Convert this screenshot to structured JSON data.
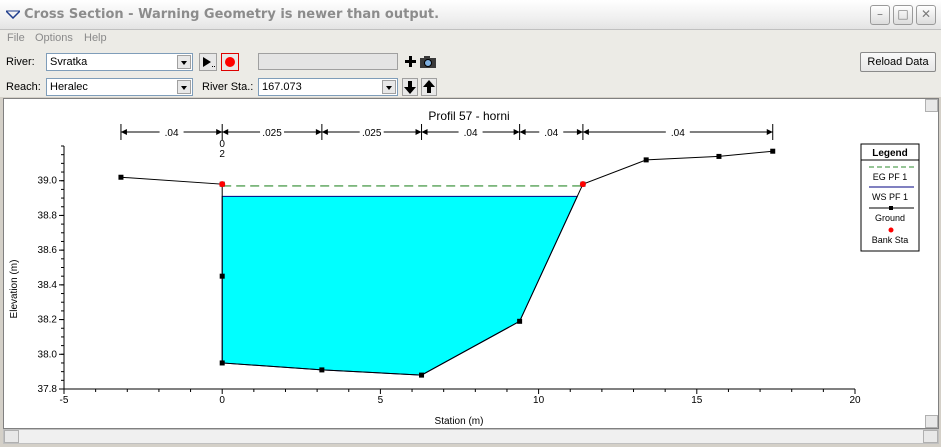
{
  "window": {
    "title": "Cross Section - Warning Geometry is newer than output."
  },
  "menu": [
    "File",
    "Options",
    "Help"
  ],
  "toolbar": {
    "river_label": "River:",
    "river_value": "Svratka",
    "reach_label": "Reach:",
    "reach_value": "Heralec",
    "river_sta_label": "River Sta.:",
    "river_sta_value": "167.073",
    "reload_label": "Reload Data"
  },
  "legend": {
    "title": "Legend",
    "items": [
      "EG PF 1",
      "WS PF 1",
      "Ground",
      "Bank Sta"
    ]
  },
  "colors": {
    "water": "#00ffff",
    "eg_line": "#2e8b2e",
    "ground": "#000000",
    "bank": "#ff0000"
  },
  "chart_data": {
    "type": "line",
    "title": "Profil 57 - horni",
    "xlabel": "Station (m)",
    "ylabel": "Elevation (m)",
    "xlim": [
      -5,
      20
    ],
    "ylim": [
      37.8,
      39.2
    ],
    "xticks": [
      -5,
      0,
      5,
      10,
      15,
      20
    ],
    "yticks": [
      37.8,
      38.0,
      38.2,
      38.4,
      38.6,
      38.8,
      39.0
    ],
    "ground": [
      {
        "x": -3.2,
        "y": 39.02
      },
      {
        "x": 0.0,
        "y": 38.98
      },
      {
        "x": 0.0,
        "y": 38.45
      },
      {
        "x": 0.0,
        "y": 37.95
      },
      {
        "x": 3.15,
        "y": 37.91
      },
      {
        "x": 6.3,
        "y": 37.88
      },
      {
        "x": 9.4,
        "y": 38.19
      },
      {
        "x": 11.4,
        "y": 38.98
      },
      {
        "x": 13.4,
        "y": 39.12
      },
      {
        "x": 15.7,
        "y": 39.14
      },
      {
        "x": 17.4,
        "y": 39.17
      }
    ],
    "ws_elevation": 38.91,
    "eg_elevation": 38.97,
    "bank_stations": [
      {
        "x": 0.0,
        "y": 38.98
      },
      {
        "x": 11.4,
        "y": 38.98
      }
    ],
    "mannings_n": [
      {
        "from": -3.2,
        "to": 0.0,
        "label": ".04"
      },
      {
        "from": 0.0,
        "to": 3.15,
        "label": ".025"
      },
      {
        "from": 3.15,
        "to": 6.3,
        "label": ".025"
      },
      {
        "from": 6.3,
        "to": 9.4,
        "label": ".04"
      },
      {
        "from": 9.4,
        "to": 11.4,
        "label": ".04"
      },
      {
        "from": 11.4,
        "to": 17.4,
        "label": ".04"
      }
    ],
    "annotation": {
      "x": 0.0,
      "lines": [
        "0",
        "2"
      ]
    },
    "legend_position": "right"
  }
}
